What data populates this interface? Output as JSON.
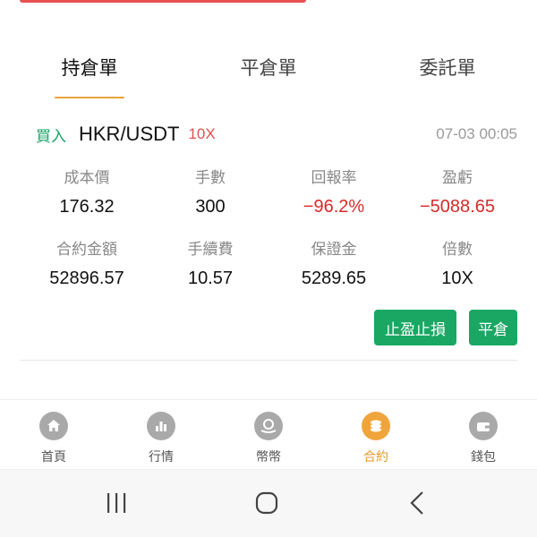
{
  "tabs": [
    {
      "label": "持倉單",
      "active": true
    },
    {
      "label": "平倉單",
      "active": false
    },
    {
      "label": "委託單",
      "active": false
    }
  ],
  "order": {
    "side": "買入",
    "pair": "HKR/USDT",
    "leverage": "10X",
    "time": "07-03 00:05",
    "fields": {
      "cost_price": {
        "label": "成本價",
        "value": "176.32"
      },
      "lots": {
        "label": "手數",
        "value": "300"
      },
      "return_rate": {
        "label": "回報率",
        "value": "−96.2%"
      },
      "pnl": {
        "label": "盈虧",
        "value": "−5088.65"
      },
      "contract_amount": {
        "label": "合約金額",
        "value": "52896.57"
      },
      "fee": {
        "label": "手續費",
        "value": "10.57"
      },
      "margin": {
        "label": "保證金",
        "value": "5289.65"
      },
      "multiplier": {
        "label": "倍數",
        "value": "10X"
      }
    },
    "buttons": {
      "tp_sl": "止盈止損",
      "close": "平倉"
    }
  },
  "nav": [
    {
      "label": "首頁",
      "icon": "home-icon",
      "active": false
    },
    {
      "label": "行情",
      "icon": "chart-icon",
      "active": false
    },
    {
      "label": "幣幣",
      "icon": "exchange-icon",
      "active": false
    },
    {
      "label": "合約",
      "icon": "coins-icon",
      "active": true
    },
    {
      "label": "錢包",
      "icon": "wallet-icon",
      "active": false
    }
  ],
  "colors": {
    "accent": "#e8a33a",
    "buy": "#17a466",
    "loss": "#d62a2a",
    "button": "#19a763"
  }
}
